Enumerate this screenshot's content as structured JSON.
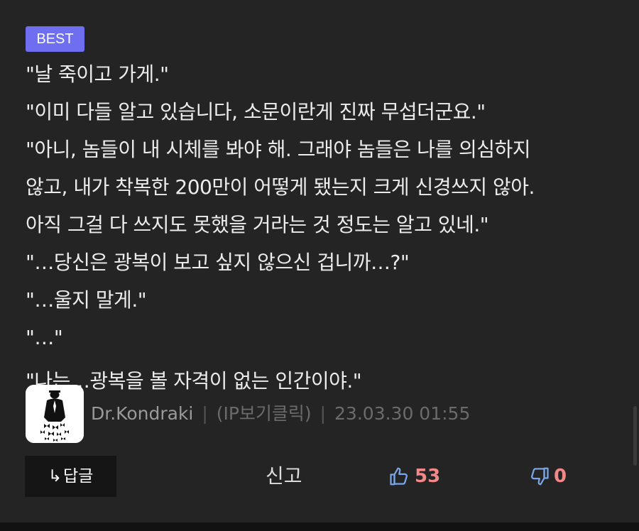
{
  "badge": {
    "label": "BEST"
  },
  "comment": {
    "lines": [
      "\"날 죽이고 가게.\"",
      "\"이미 다들 알고 있습니다, 소문이란게 진짜 무섭더군요.\"",
      "\"아니, 놈들이 내 시체를 봐야 해. 그래야 놈들은 나를 의심하지",
      "않고, 내가 착복한 200만이 어떻게 됐는지 크게 신경쓰지 않아.",
      "아직 그걸 다 쓰지도 못했을 거라는 것 정도는 알고 있네.\"",
      "\"…당신은 광복이 보고 싶지 않으신 겁니까…?\"",
      "\"…울지 말게.\"",
      "\"…\"",
      "\"나는…광복을 볼 자격이 없는 인간이야.\""
    ]
  },
  "author": {
    "name": "Dr.Kondraki",
    "separator": "|",
    "ip": "(IP보기클릭)",
    "date": "23.03.30 01:55",
    "avatar_icon": "silhouette-butterflies-icon"
  },
  "actions": {
    "reply_arrow": "↳",
    "reply_label": "답글",
    "report_label": "신고",
    "upvote_count": "53",
    "downvote_count": "0",
    "upvote_icon": "thumbs-up-icon",
    "downvote_icon": "thumbs-down-icon"
  },
  "colors": {
    "background": "#242424",
    "badge": "#6f6ef0",
    "vote_count": "#f28888",
    "vote_icon": "#7aa6e8"
  }
}
